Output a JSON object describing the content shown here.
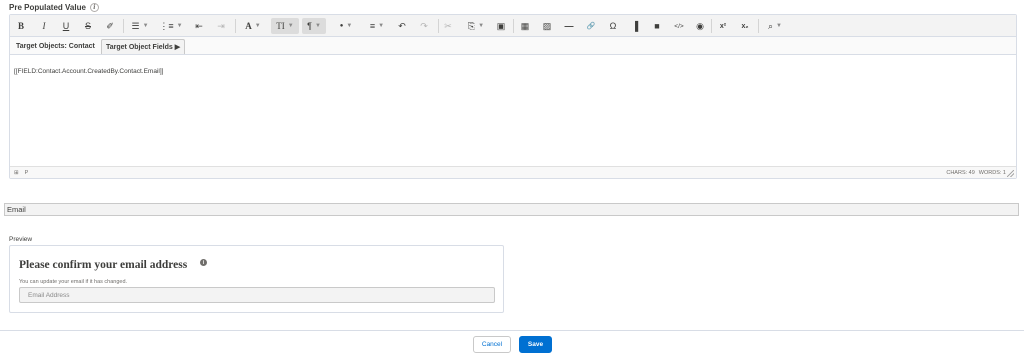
{
  "field": {
    "label": "Pre Populated Value",
    "info_glyph": "i"
  },
  "toolbar": {
    "buttons": [
      {
        "name": "bold",
        "glyph": "B",
        "caret": false
      },
      {
        "name": "italic",
        "glyph": "I",
        "caret": false
      },
      {
        "name": "underline",
        "glyph": "U",
        "caret": false
      },
      {
        "name": "strikethrough",
        "glyph": "S",
        "caret": false
      },
      {
        "name": "remove-format",
        "glyph": "✐",
        "caret": false
      },
      {
        "name": "bulleted-list",
        "glyph": "☰",
        "caret": true
      },
      {
        "name": "numbered-list",
        "glyph": "⋮≡",
        "caret": true
      },
      {
        "name": "outdent",
        "glyph": "⇤",
        "caret": false
      },
      {
        "name": "indent",
        "glyph": "⇥",
        "caret": false
      },
      {
        "name": "font-color",
        "glyph": "A",
        "caret": true
      },
      {
        "name": "font-size",
        "glyph": "TI",
        "caret": true
      },
      {
        "name": "paragraph-format",
        "glyph": "¶",
        "caret": true
      },
      {
        "name": "inline-style",
        "glyph": "●",
        "caret": true
      },
      {
        "name": "align",
        "glyph": "≡",
        "caret": true
      },
      {
        "name": "undo",
        "glyph": "↶",
        "caret": false
      },
      {
        "name": "redo",
        "glyph": "↷",
        "caret": false
      },
      {
        "name": "cut",
        "glyph": "✂",
        "caret": false
      },
      {
        "name": "paste",
        "glyph": "⎘",
        "caret": true
      },
      {
        "name": "select-all",
        "glyph": "▣",
        "caret": false
      },
      {
        "name": "table",
        "glyph": "▦",
        "caret": false
      },
      {
        "name": "image",
        "glyph": "▨",
        "caret": false
      },
      {
        "name": "horizontal-line",
        "glyph": "—",
        "caret": false
      },
      {
        "name": "link",
        "glyph": "🔗",
        "caret": false
      },
      {
        "name": "special-chars",
        "glyph": "Ω",
        "caret": false
      },
      {
        "name": "file",
        "glyph": "▐",
        "caret": false
      },
      {
        "name": "video",
        "glyph": "■",
        "caret": false
      },
      {
        "name": "code-view",
        "glyph": "</>",
        "caret": false
      },
      {
        "name": "preview",
        "glyph": "◉",
        "caret": false
      },
      {
        "name": "superscript",
        "glyph": "x²",
        "caret": false
      },
      {
        "name": "subscript",
        "glyph": "x₂",
        "caret": false
      },
      {
        "name": "find",
        "glyph": "⌕",
        "caret": true
      }
    ]
  },
  "tabs": {
    "target_objects": "Target Objects: Contact",
    "target_fields": "Target Object Fields ▶"
  },
  "editor": {
    "content": "[[FIELD:Contact.Account.CreatedBy.Contact.Email]]",
    "status_left_1": "⊞",
    "status_left_2": "P",
    "chars": "CHARS: 49",
    "words": "WORDS: 1"
  },
  "value_bar": {
    "text": "Email"
  },
  "preview": {
    "label": "Preview",
    "title": "Please confirm your email address",
    "info_glyph": "i",
    "help": "You can update your email if it has changed.",
    "input_placeholder": "Email Address"
  },
  "footer": {
    "cancel_label": "Cancel",
    "save_label": "Save"
  },
  "colors": {
    "brand": "#0070d2",
    "border": "#d8dde6",
    "toolbar_bg": "#f3f3f3"
  }
}
